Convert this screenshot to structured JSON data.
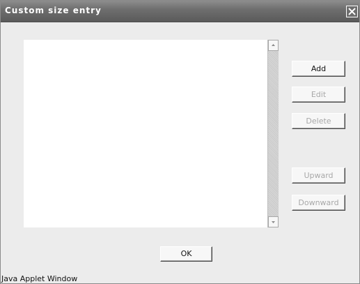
{
  "window": {
    "title": "Custom size entry",
    "close_icon": "close-x-icon"
  },
  "list": {
    "items": [],
    "scroll_up_icon": "scroll-up-arrow-icon",
    "scroll_down_icon": "scroll-down-arrow-icon"
  },
  "buttons": {
    "add": "Add",
    "edit": "Edit",
    "delete": "Delete",
    "upward": "Upward",
    "downward": "Downward",
    "ok": "OK"
  },
  "status_bar": {
    "text": "Java Applet Window"
  },
  "colors": {
    "title_bar": "#6f6f6f",
    "window_background": "#ececec",
    "disabled_text": "#a8a8a8"
  }
}
